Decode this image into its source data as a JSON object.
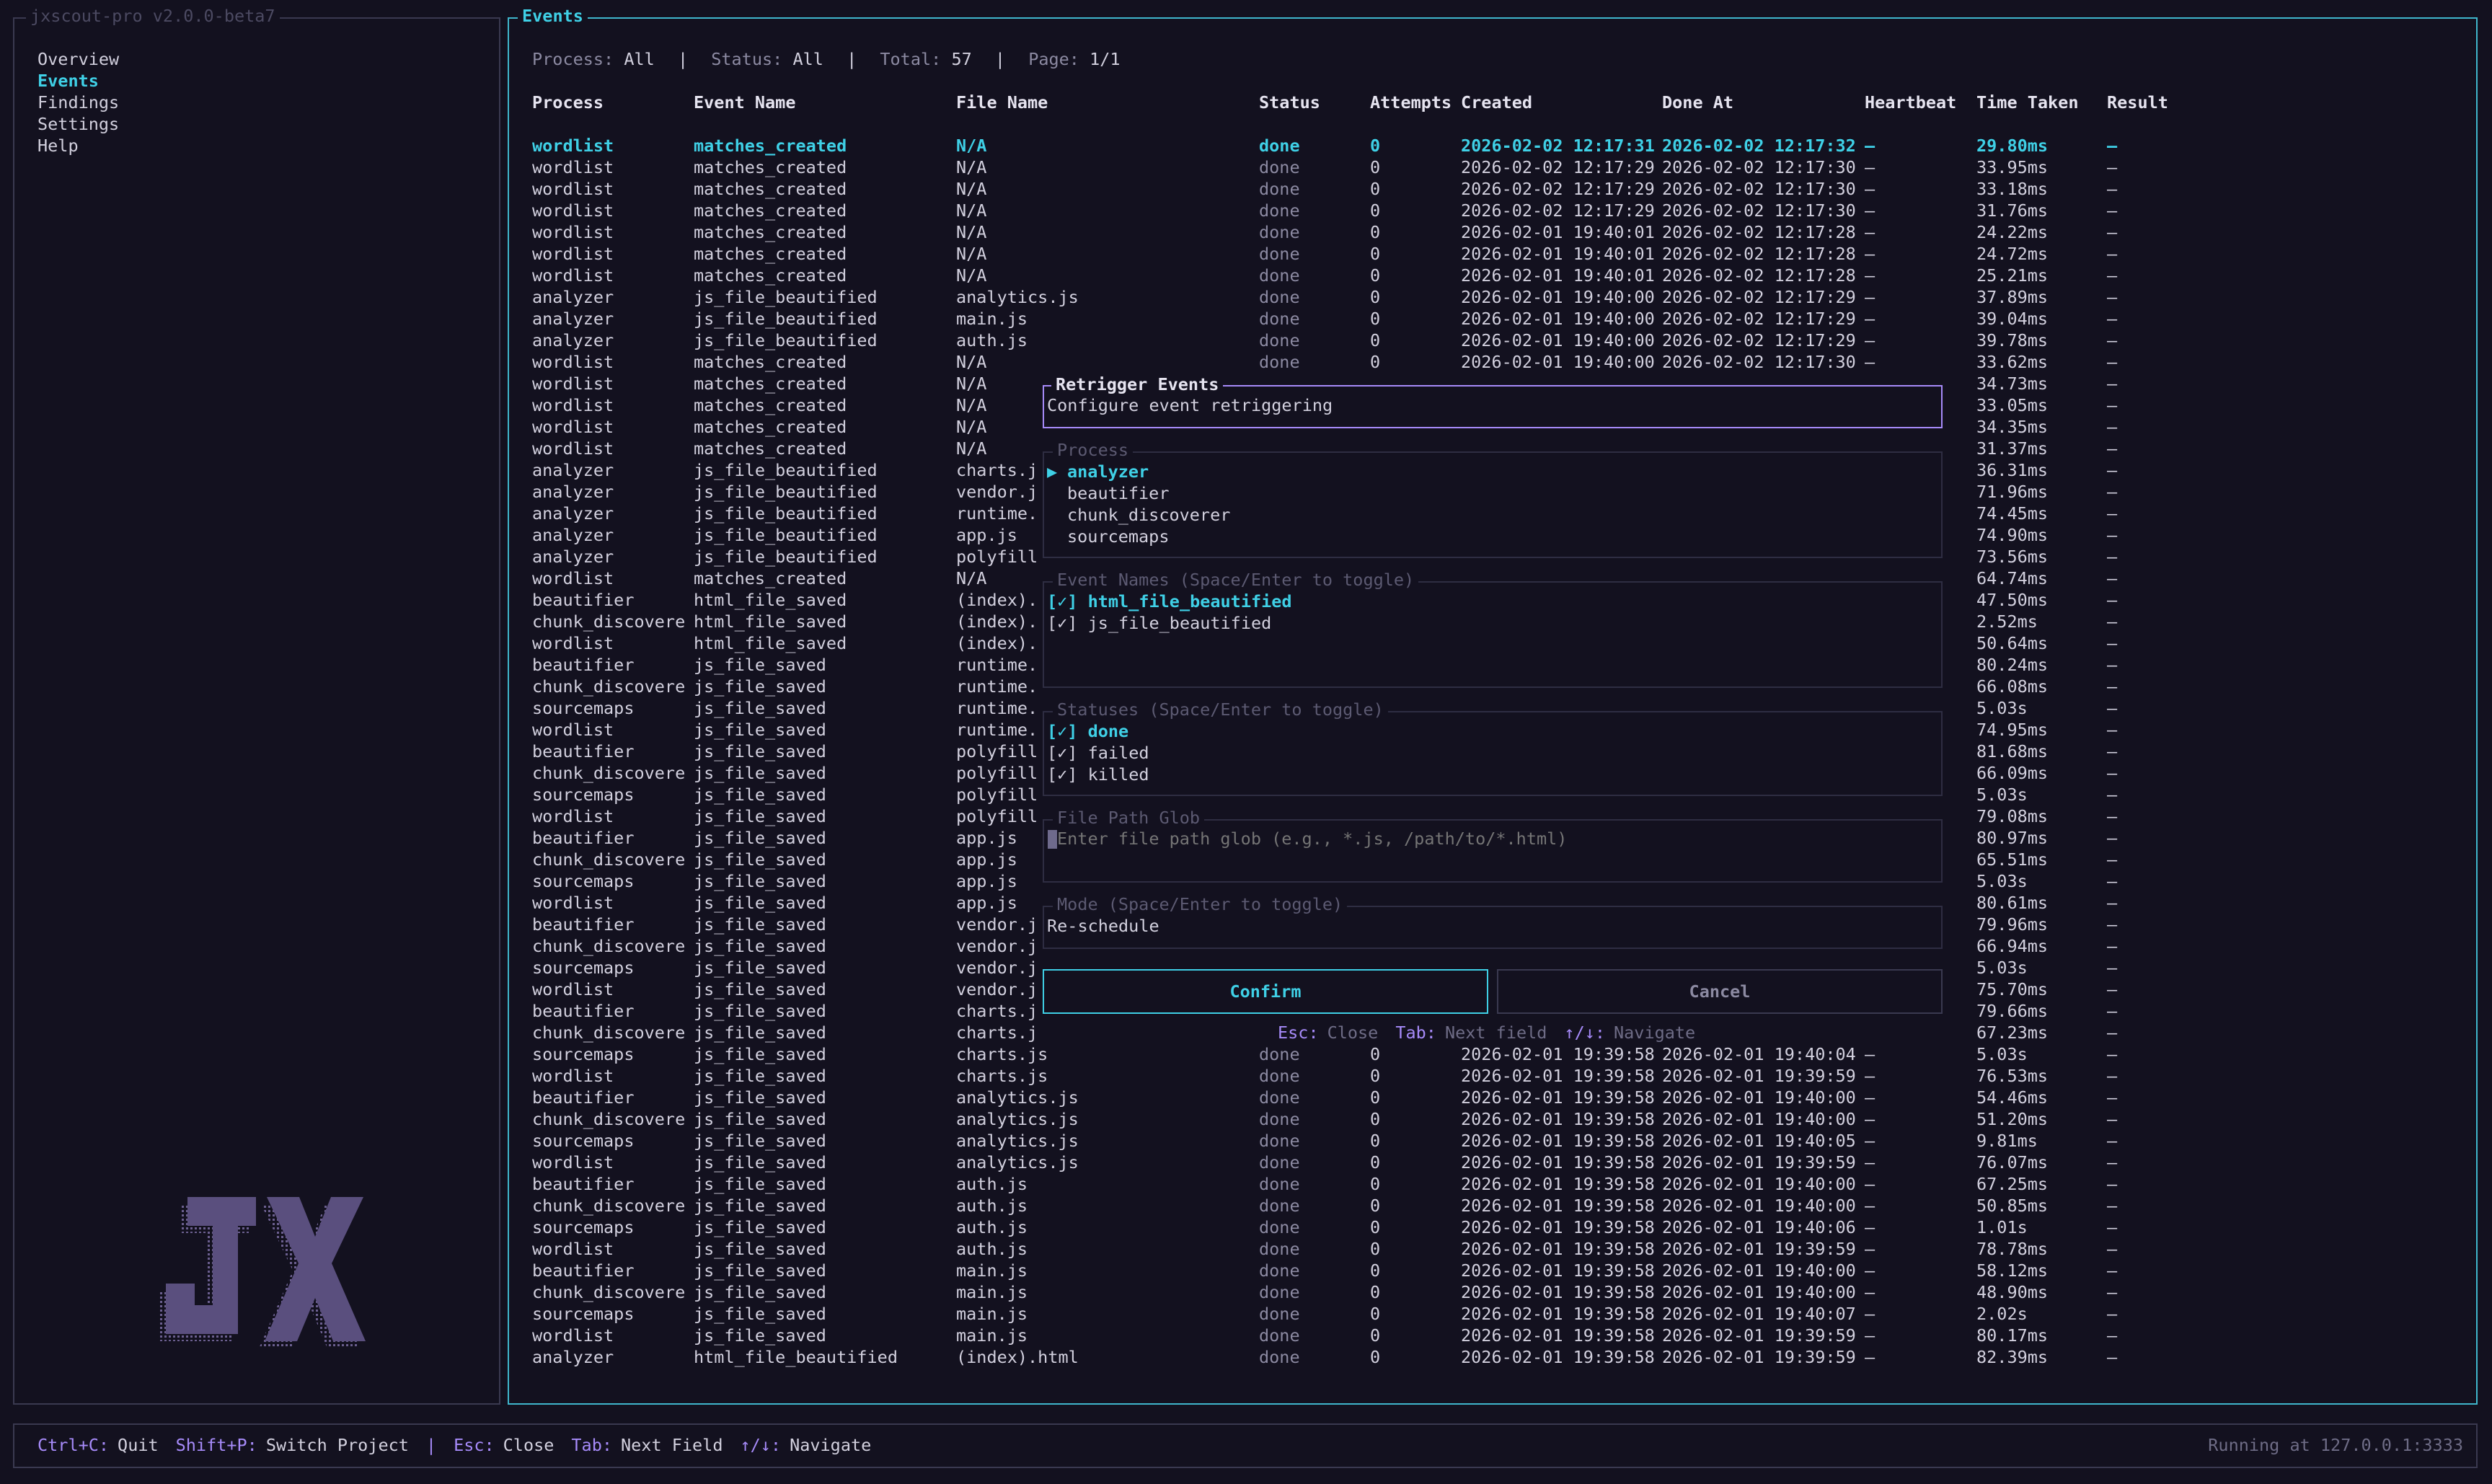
{
  "app": {
    "title": "jxscout-pro v2.0.0-beta7"
  },
  "sidebar": {
    "items": [
      {
        "label": "Overview",
        "active": false
      },
      {
        "label": "Events",
        "active": true
      },
      {
        "label": "Findings",
        "active": false
      },
      {
        "label": "Settings",
        "active": false
      },
      {
        "label": "Help",
        "active": false
      }
    ],
    "logo_text": "JX"
  },
  "events": {
    "title": "Events",
    "filter": {
      "process_label": "Process:",
      "process": "All",
      "status_label": "Status:",
      "status": "All",
      "total_label": "Total:",
      "total": "57",
      "page_label": "Page:",
      "page": "1/1",
      "sep": "|"
    },
    "columns": [
      "Process",
      "Event Name",
      "File Name",
      "Status",
      "Attempts",
      "Created",
      "Done At",
      "Heartbeat",
      "Time Taken",
      "Result"
    ],
    "rows": [
      [
        "wordlist",
        "matches_created",
        "N/A",
        "done",
        "0",
        "2026-02-02 12:17:31",
        "2026-02-02 12:17:32",
        "—",
        "29.80ms",
        "—"
      ],
      [
        "wordlist",
        "matches_created",
        "N/A",
        "done",
        "0",
        "2026-02-02 12:17:29",
        "2026-02-02 12:17:30",
        "—",
        "33.95ms",
        "—"
      ],
      [
        "wordlist",
        "matches_created",
        "N/A",
        "done",
        "0",
        "2026-02-02 12:17:29",
        "2026-02-02 12:17:30",
        "—",
        "33.18ms",
        "—"
      ],
      [
        "wordlist",
        "matches_created",
        "N/A",
        "done",
        "0",
        "2026-02-02 12:17:29",
        "2026-02-02 12:17:30",
        "—",
        "31.76ms",
        "—"
      ],
      [
        "wordlist",
        "matches_created",
        "N/A",
        "done",
        "0",
        "2026-02-01 19:40:01",
        "2026-02-02 12:17:28",
        "—",
        "24.22ms",
        "—"
      ],
      [
        "wordlist",
        "matches_created",
        "N/A",
        "done",
        "0",
        "2026-02-01 19:40:01",
        "2026-02-02 12:17:28",
        "—",
        "24.72ms",
        "—"
      ],
      [
        "wordlist",
        "matches_created",
        "N/A",
        "done",
        "0",
        "2026-02-01 19:40:01",
        "2026-02-02 12:17:28",
        "—",
        "25.21ms",
        "—"
      ],
      [
        "analyzer",
        "js_file_beautified",
        "analytics.js",
        "done",
        "0",
        "2026-02-01 19:40:00",
        "2026-02-02 12:17:29",
        "—",
        "37.89ms",
        "—"
      ],
      [
        "analyzer",
        "js_file_beautified",
        "main.js",
        "done",
        "0",
        "2026-02-01 19:40:00",
        "2026-02-02 12:17:29",
        "—",
        "39.04ms",
        "—"
      ],
      [
        "analyzer",
        "js_file_beautified",
        "auth.js",
        "done",
        "0",
        "2026-02-01 19:40:00",
        "2026-02-02 12:17:29",
        "—",
        "39.78ms",
        "—"
      ],
      [
        "wordlist",
        "matches_created",
        "N/A",
        "done",
        "0",
        "2026-02-01 19:40:00",
        "2026-02-02 12:17:30",
        "—",
        "33.62ms",
        "—"
      ],
      [
        "wordlist",
        "matches_created",
        "N/A",
        "",
        "",
        "",
        "",
        "",
        "34.73ms",
        "—"
      ],
      [
        "wordlist",
        "matches_created",
        "N/A",
        "",
        "",
        "",
        "",
        "",
        "33.05ms",
        "—"
      ],
      [
        "wordlist",
        "matches_created",
        "N/A",
        "",
        "",
        "",
        "",
        "",
        "34.35ms",
        "—"
      ],
      [
        "wordlist",
        "matches_created",
        "N/A",
        "",
        "",
        "",
        "",
        "",
        "31.37ms",
        "—"
      ],
      [
        "analyzer",
        "js_file_beautified",
        "charts.j",
        "",
        "",
        "",
        "",
        "",
        "36.31ms",
        "—"
      ],
      [
        "analyzer",
        "js_file_beautified",
        "vendor.j",
        "",
        "",
        "",
        "",
        "",
        "71.96ms",
        "—"
      ],
      [
        "analyzer",
        "js_file_beautified",
        "runtime.",
        "",
        "",
        "",
        "",
        "",
        "74.45ms",
        "—"
      ],
      [
        "analyzer",
        "js_file_beautified",
        "app.js",
        "",
        "",
        "",
        "",
        "",
        "74.90ms",
        "—"
      ],
      [
        "analyzer",
        "js_file_beautified",
        "polyfill",
        "",
        "",
        "",
        "",
        "",
        "73.56ms",
        "—"
      ],
      [
        "wordlist",
        "matches_created",
        "N/A",
        "",
        "",
        "",
        "",
        "",
        "64.74ms",
        "—"
      ],
      [
        "beautifier",
        "html_file_saved",
        "(index).",
        "",
        "",
        "",
        "",
        "",
        "47.50ms",
        "—"
      ],
      [
        "chunk_discovere",
        "html_file_saved",
        "(index).",
        "",
        "",
        "",
        "",
        "",
        "2.52ms",
        "—"
      ],
      [
        "wordlist",
        "html_file_saved",
        "(index).",
        "",
        "",
        "",
        "",
        "",
        "50.64ms",
        "—"
      ],
      [
        "beautifier",
        "js_file_saved",
        "runtime.",
        "",
        "",
        "",
        "",
        "",
        "80.24ms",
        "—"
      ],
      [
        "chunk_discovere",
        "js_file_saved",
        "runtime.",
        "",
        "",
        "",
        "",
        "",
        "66.08ms",
        "—"
      ],
      [
        "sourcemaps",
        "js_file_saved",
        "runtime.",
        "",
        "",
        "",
        "",
        "",
        "5.03s",
        "—"
      ],
      [
        "wordlist",
        "js_file_saved",
        "runtime.",
        "",
        "",
        "",
        "",
        "",
        "74.95ms",
        "—"
      ],
      [
        "beautifier",
        "js_file_saved",
        "polyfill",
        "",
        "",
        "",
        "",
        "",
        "81.68ms",
        "—"
      ],
      [
        "chunk_discovere",
        "js_file_saved",
        "polyfill",
        "",
        "",
        "",
        "",
        "",
        "66.09ms",
        "—"
      ],
      [
        "sourcemaps",
        "js_file_saved",
        "polyfill",
        "",
        "",
        "",
        "",
        "",
        "5.03s",
        "—"
      ],
      [
        "wordlist",
        "js_file_saved",
        "polyfill",
        "",
        "",
        "",
        "",
        "",
        "79.08ms",
        "—"
      ],
      [
        "beautifier",
        "js_file_saved",
        "app.js",
        "",
        "",
        "",
        "",
        "",
        "80.97ms",
        "—"
      ],
      [
        "chunk_discovere",
        "js_file_saved",
        "app.js",
        "",
        "",
        "",
        "",
        "",
        "65.51ms",
        "—"
      ],
      [
        "sourcemaps",
        "js_file_saved",
        "app.js",
        "",
        "",
        "",
        "",
        "",
        "5.03s",
        "—"
      ],
      [
        "wordlist",
        "js_file_saved",
        "app.js",
        "",
        "",
        "",
        "",
        "",
        "80.61ms",
        "—"
      ],
      [
        "beautifier",
        "js_file_saved",
        "vendor.j",
        "",
        "",
        "",
        "",
        "",
        "79.96ms",
        "—"
      ],
      [
        "chunk_discovere",
        "js_file_saved",
        "vendor.j",
        "",
        "",
        "",
        "",
        "",
        "66.94ms",
        "—"
      ],
      [
        "sourcemaps",
        "js_file_saved",
        "vendor.j",
        "",
        "",
        "",
        "",
        "",
        "5.03s",
        "—"
      ],
      [
        "wordlist",
        "js_file_saved",
        "vendor.j",
        "",
        "",
        "",
        "",
        "",
        "75.70ms",
        "—"
      ],
      [
        "beautifier",
        "js_file_saved",
        "charts.j",
        "",
        "",
        "",
        "",
        "",
        "79.66ms",
        "—"
      ],
      [
        "chunk_discovere",
        "js_file_saved",
        "charts.j",
        "",
        "",
        "",
        "",
        "",
        "67.23ms",
        "—"
      ],
      [
        "sourcemaps",
        "js_file_saved",
        "charts.js",
        "done",
        "0",
        "2026-02-01 19:39:58",
        "2026-02-01 19:40:04",
        "—",
        "5.03s",
        "—"
      ],
      [
        "wordlist",
        "js_file_saved",
        "charts.js",
        "done",
        "0",
        "2026-02-01 19:39:58",
        "2026-02-01 19:39:59",
        "—",
        "76.53ms",
        "—"
      ],
      [
        "beautifier",
        "js_file_saved",
        "analytics.js",
        "done",
        "0",
        "2026-02-01 19:39:58",
        "2026-02-01 19:40:00",
        "—",
        "54.46ms",
        "—"
      ],
      [
        "chunk_discovere",
        "js_file_saved",
        "analytics.js",
        "done",
        "0",
        "2026-02-01 19:39:58",
        "2026-02-01 19:40:00",
        "—",
        "51.20ms",
        "—"
      ],
      [
        "sourcemaps",
        "js_file_saved",
        "analytics.js",
        "done",
        "0",
        "2026-02-01 19:39:58",
        "2026-02-01 19:40:05",
        "—",
        "9.81ms",
        "—"
      ],
      [
        "wordlist",
        "js_file_saved",
        "analytics.js",
        "done",
        "0",
        "2026-02-01 19:39:58",
        "2026-02-01 19:39:59",
        "—",
        "76.07ms",
        "—"
      ],
      [
        "beautifier",
        "js_file_saved",
        "auth.js",
        "done",
        "0",
        "2026-02-01 19:39:58",
        "2026-02-01 19:40:00",
        "—",
        "67.25ms",
        "—"
      ],
      [
        "chunk_discovere",
        "js_file_saved",
        "auth.js",
        "done",
        "0",
        "2026-02-01 19:39:58",
        "2026-02-01 19:40:00",
        "—",
        "50.85ms",
        "—"
      ],
      [
        "sourcemaps",
        "js_file_saved",
        "auth.js",
        "done",
        "0",
        "2026-02-01 19:39:58",
        "2026-02-01 19:40:06",
        "—",
        "1.01s",
        "—"
      ],
      [
        "wordlist",
        "js_file_saved",
        "auth.js",
        "done",
        "0",
        "2026-02-01 19:39:58",
        "2026-02-01 19:39:59",
        "—",
        "78.78ms",
        "—"
      ],
      [
        "beautifier",
        "js_file_saved",
        "main.js",
        "done",
        "0",
        "2026-02-01 19:39:58",
        "2026-02-01 19:40:00",
        "—",
        "58.12ms",
        "—"
      ],
      [
        "chunk_discovere",
        "js_file_saved",
        "main.js",
        "done",
        "0",
        "2026-02-01 19:39:58",
        "2026-02-01 19:40:00",
        "—",
        "48.90ms",
        "—"
      ],
      [
        "sourcemaps",
        "js_file_saved",
        "main.js",
        "done",
        "0",
        "2026-02-01 19:39:58",
        "2026-02-01 19:40:07",
        "—",
        "2.02s",
        "—"
      ],
      [
        "wordlist",
        "js_file_saved",
        "main.js",
        "done",
        "0",
        "2026-02-01 19:39:58",
        "2026-02-01 19:39:59",
        "—",
        "80.17ms",
        "—"
      ],
      [
        "analyzer",
        "html_file_beautified",
        "(index).html",
        "done",
        "0",
        "2026-02-01 19:39:58",
        "2026-02-01 19:39:59",
        "—",
        "82.39ms",
        "—"
      ]
    ]
  },
  "modal": {
    "title": "Retrigger Events",
    "subtitle": "Configure event retriggering",
    "process": {
      "legend": "Process",
      "selected_marker": "▶",
      "options": [
        "analyzer",
        "beautifier",
        "chunk_discoverer",
        "sourcemaps"
      ]
    },
    "event_names": {
      "legend": "Event Names (Space/Enter to toggle)",
      "options": [
        {
          "mark": "[✓]",
          "label": "html_file_beautified"
        },
        {
          "mark": "[✓]",
          "label": "js_file_beautified"
        }
      ]
    },
    "statuses": {
      "legend": "Statuses (Space/Enter to toggle)",
      "options": [
        {
          "mark": "[✓]",
          "label": "done"
        },
        {
          "mark": "[✓]",
          "label": "failed"
        },
        {
          "mark": "[✓]",
          "label": "killed"
        }
      ]
    },
    "glob": {
      "legend": "File Path Glob",
      "placeholder": "Enter file path glob (e.g., *.js, /path/to/*.html)"
    },
    "mode": {
      "legend": "Mode (Space/Enter to toggle)",
      "value": "Re-schedule"
    },
    "confirm": "Confirm",
    "cancel": "Cancel",
    "hints": [
      {
        "key": "Esc:",
        "text": "Close"
      },
      {
        "key": "Tab:",
        "text": "Next field"
      },
      {
        "key": "↑/↓:",
        "text": "Navigate"
      }
    ]
  },
  "footer": {
    "hints": [
      {
        "key": "Ctrl+C:",
        "text": "Quit"
      },
      {
        "key": "Shift+P:",
        "text": "Switch Project"
      },
      {
        "key": "|",
        "text": ""
      },
      {
        "key": "Esc:",
        "text": "Close"
      },
      {
        "key": "Tab:",
        "text": "Next Field"
      },
      {
        "key": "↑/↓:",
        "text": "Navigate"
      }
    ],
    "status": "Running at 127.0.0.1:3333"
  },
  "colors": {
    "background": "#13111f",
    "accent": "#3fd0e6",
    "purple": "#a78bfa",
    "border_dim": "#3a3950",
    "text": "#d2d0de",
    "muted": "#8c8aa2"
  }
}
